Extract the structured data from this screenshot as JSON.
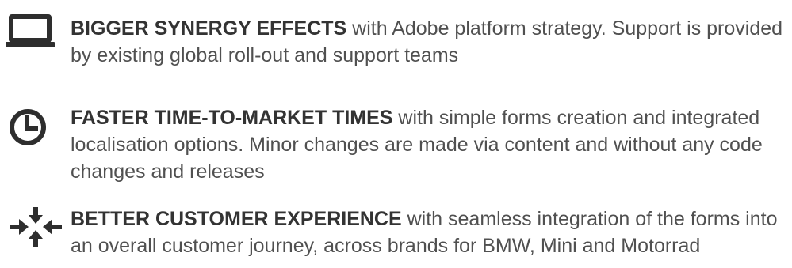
{
  "colors": {
    "text": "#505050",
    "headline": "#333333",
    "icon": "#2e2e2e"
  },
  "benefits": [
    {
      "icon": "laptop-icon",
      "headline": "BIGGER SYNERGY EFFECTS",
      "body": " with Adobe platform strategy. Support is provided by existing global roll-out and support teams"
    },
    {
      "icon": "clock-icon",
      "headline": "FASTER TIME-TO-MARKET TIMES",
      "body": " with simple forms creation and integrated localisation options. Minor changes are made via content and without any code changes and releases"
    },
    {
      "icon": "converge-arrows-icon",
      "headline": "BETTER CUSTOMER EXPERIENCE",
      "body": " with seamless integration of the forms into an overall customer journey, across brands for BMW, Mini and Motorrad"
    }
  ]
}
